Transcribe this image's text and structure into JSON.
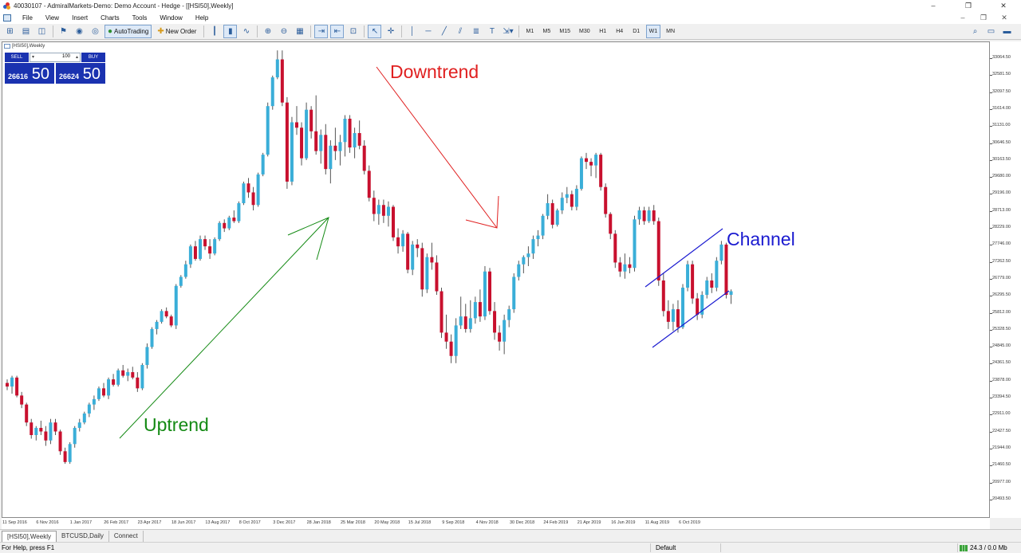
{
  "window": {
    "title": "40030107 - AdmiralMarkets-Demo: Demo Account - Hedge - [[HSI50],Weekly]",
    "controls": [
      "–",
      "❐",
      "✕"
    ]
  },
  "menu": {
    "items": [
      "File",
      "View",
      "Insert",
      "Charts",
      "Tools",
      "Window",
      "Help"
    ],
    "child_controls": [
      "–",
      "❐",
      "✕"
    ]
  },
  "toolbar": {
    "autotrading_label": "AutoTrading",
    "new_order_label": "New Order",
    "timeframes": [
      "M1",
      "M5",
      "M15",
      "M30",
      "H1",
      "H4",
      "D1",
      "W1",
      "MN"
    ],
    "active_timeframe": "W1"
  },
  "chart": {
    "header": "[HSI50],Weekly",
    "trade_panel": {
      "sell_label": "SELL",
      "buy_label": "BUY",
      "volume": "100",
      "sell_price_small": "26616",
      "sell_price_big": "50",
      "buy_price_small": "26624",
      "buy_price_big": "50"
    },
    "annotations": {
      "downtrend": "Downtrend",
      "uptrend": "Uptrend",
      "channel": "Channel"
    },
    "colors": {
      "bull": "#3aaed8",
      "bear": "#c8102e",
      "downtrend_line": "#e02020",
      "uptrend_line": "#148a14",
      "channel_line": "#1a1ad0"
    },
    "price_labels": [
      "33064.50",
      "32581.50",
      "32097.50",
      "31614.00",
      "31131.00",
      "30646.50",
      "30163.50",
      "29680.00",
      "29196.00",
      "28713.00",
      "28229.00",
      "27746.00",
      "27262.50",
      "26779.00",
      "26295.50",
      "25812.00",
      "25328.50",
      "24845.00",
      "24361.50",
      "23878.00",
      "23394.50",
      "22911.00",
      "22427.50",
      "21944.00",
      "21460.50",
      "20977.00",
      "20493.50"
    ],
    "time_labels": [
      "11 Sep 2016",
      "6 Nov 2016",
      "1 Jan 2017",
      "26 Feb 2017",
      "23 Apr 2017",
      "18 Jun 2017",
      "13 Aug 2017",
      "8 Oct 2017",
      "3 Dec 2017",
      "28 Jan 2018",
      "25 Mar 2018",
      "20 May 2018",
      "15 Jul 2018",
      "9 Sep 2018",
      "4 Nov 2018",
      "30 Dec 2018",
      "24 Feb 2019",
      "21 Apr 2019",
      "16 Jun 2019",
      "11 Aug 2019",
      "6 Oct 2019"
    ]
  },
  "chart_data": {
    "type": "candlestick",
    "symbol": "[HSI50]",
    "timeframe": "Weekly",
    "ylim": [
      20300,
      33200
    ],
    "candles": [
      [
        23900,
        24000,
        23700,
        23800
      ],
      [
        23800,
        24100,
        23600,
        24050
      ],
      [
        24050,
        24100,
        23500,
        23550
      ],
      [
        23550,
        23650,
        23200,
        23300
      ],
      [
        23300,
        23350,
        22700,
        22800
      ],
      [
        22800,
        22900,
        22350,
        22450
      ],
      [
        22450,
        22700,
        22300,
        22650
      ],
      [
        22650,
        22850,
        22450,
        22550
      ],
      [
        22550,
        22700,
        22150,
        22300
      ],
      [
        22300,
        22900,
        22200,
        22800
      ],
      [
        22800,
        22900,
        22450,
        22550
      ],
      [
        22550,
        22600,
        21900,
        22000
      ],
      [
        22000,
        22100,
        21650,
        21700
      ],
      [
        21700,
        22250,
        21650,
        22200
      ],
      [
        22200,
        22700,
        22100,
        22650
      ],
      [
        22650,
        22900,
        22550,
        22800
      ],
      [
        22800,
        23100,
        22750,
        23050
      ],
      [
        23050,
        23350,
        22950,
        23300
      ],
      [
        23300,
        23550,
        23150,
        23450
      ],
      [
        23450,
        23800,
        23400,
        23750
      ],
      [
        23750,
        23900,
        23500,
        23550
      ],
      [
        23550,
        24050,
        23450,
        24000
      ],
      [
        24000,
        24150,
        23800,
        23850
      ],
      [
        23850,
        24300,
        23800,
        24250
      ],
      [
        24250,
        24400,
        24050,
        24100
      ],
      [
        24100,
        24300,
        23950,
        24200
      ],
      [
        24200,
        24350,
        24000,
        24050
      ],
      [
        24050,
        24200,
        23650,
        23750
      ],
      [
        23750,
        24450,
        23700,
        24400
      ],
      [
        24400,
        25000,
        24300,
        24900
      ],
      [
        24900,
        25450,
        24850,
        25400
      ],
      [
        25400,
        25650,
        25250,
        25600
      ],
      [
        25600,
        25950,
        25550,
        25900
      ],
      [
        25900,
        26000,
        25700,
        25750
      ],
      [
        25750,
        25800,
        25450,
        25500
      ],
      [
        25500,
        26650,
        25400,
        26600
      ],
      [
        26600,
        26900,
        26550,
        26850
      ],
      [
        26850,
        27300,
        26800,
        27200
      ],
      [
        27200,
        27750,
        27100,
        27700
      ],
      [
        27700,
        27850,
        27300,
        27350
      ],
      [
        27350,
        28000,
        27300,
        27900
      ],
      [
        27900,
        28000,
        27600,
        27700
      ],
      [
        27700,
        27900,
        27350,
        27500
      ],
      [
        27500,
        27950,
        27450,
        27900
      ],
      [
        27900,
        28400,
        27850,
        28350
      ],
      [
        28350,
        28450,
        28100,
        28200
      ],
      [
        28200,
        28550,
        28150,
        28500
      ],
      [
        28500,
        28700,
        28350,
        28400
      ],
      [
        28400,
        28950,
        28350,
        28900
      ],
      [
        28900,
        29500,
        28850,
        29450
      ],
      [
        29450,
        29600,
        29050,
        29200
      ],
      [
        29200,
        29350,
        28700,
        28850
      ],
      [
        28850,
        29750,
        28800,
        29700
      ],
      [
        29700,
        30300,
        29650,
        30250
      ],
      [
        30250,
        31700,
        30200,
        31600
      ],
      [
        31600,
        32450,
        31500,
        32400
      ],
      [
        32400,
        33150,
        32350,
        32900
      ],
      [
        32900,
        33150,
        31600,
        31700
      ],
      [
        31700,
        31850,
        29300,
        29500
      ],
      [
        29500,
        31300,
        29400,
        31150
      ],
      [
        31150,
        31600,
        30800,
        31000
      ],
      [
        31000,
        31150,
        29950,
        30150
      ],
      [
        30150,
        31700,
        30100,
        31500
      ],
      [
        31500,
        31600,
        30700,
        30900
      ],
      [
        30900,
        31900,
        30250,
        30350
      ],
      [
        30350,
        30950,
        30000,
        30800
      ],
      [
        30800,
        31100,
        29700,
        29850
      ],
      [
        29850,
        30650,
        29450,
        30500
      ],
      [
        30500,
        31000,
        30100,
        30350
      ],
      [
        30350,
        30800,
        29950,
        30600
      ],
      [
        30600,
        31350,
        30200,
        31250
      ],
      [
        31250,
        31350,
        30300,
        30450
      ],
      [
        30450,
        31000,
        30150,
        30850
      ],
      [
        30850,
        31200,
        30400,
        30500
      ],
      [
        30500,
        30650,
        29700,
        29800
      ],
      [
        29800,
        29950,
        28950,
        29050
      ],
      [
        29050,
        29250,
        28400,
        28600
      ],
      [
        28600,
        29000,
        28300,
        28850
      ],
      [
        28850,
        29000,
        28350,
        28550
      ],
      [
        28550,
        28950,
        28250,
        28800
      ],
      [
        28800,
        28850,
        27850,
        27950
      ],
      [
        27950,
        28200,
        27500,
        27700
      ],
      [
        27700,
        28150,
        27550,
        28050
      ],
      [
        28050,
        28100,
        26950,
        27050
      ],
      [
        27050,
        27850,
        26900,
        27750
      ],
      [
        27750,
        27900,
        27400,
        27650
      ],
      [
        27650,
        27800,
        26300,
        26500
      ],
      [
        26500,
        27500,
        26400,
        27400
      ],
      [
        27400,
        27800,
        27050,
        27250
      ],
      [
        27250,
        27450,
        26350,
        26450
      ],
      [
        26450,
        26550,
        25150,
        25300
      ],
      [
        25300,
        25800,
        24850,
        25050
      ],
      [
        25050,
        25250,
        24450,
        24650
      ],
      [
        24650,
        25700,
        24450,
        25500
      ],
      [
        25500,
        26300,
        25400,
        25750
      ],
      [
        25750,
        26100,
        25300,
        25400
      ],
      [
        25400,
        26200,
        25300,
        25700
      ],
      [
        25700,
        26300,
        25550,
        26150
      ],
      [
        26150,
        26500,
        25600,
        25750
      ],
      [
        25750,
        27150,
        25650,
        27000
      ],
      [
        27000,
        27100,
        25800,
        25900
      ],
      [
        25900,
        26150,
        25100,
        25300
      ],
      [
        25300,
        25500,
        24800,
        25050
      ],
      [
        25050,
        25800,
        24700,
        25650
      ],
      [
        25650,
        26050,
        25450,
        25950
      ],
      [
        25950,
        26950,
        25850,
        26850
      ],
      [
        26850,
        27300,
        26750,
        27200
      ],
      [
        27200,
        27450,
        26950,
        27400
      ],
      [
        27400,
        27700,
        27150,
        27500
      ],
      [
        27500,
        28000,
        27350,
        27900
      ],
      [
        27900,
        28150,
        27700,
        28000
      ],
      [
        28000,
        28600,
        27900,
        28550
      ],
      [
        28550,
        29150,
        28450,
        28900
      ],
      [
        28900,
        29000,
        28200,
        28300
      ],
      [
        28300,
        28750,
        28250,
        28700
      ],
      [
        28700,
        29200,
        28600,
        29050
      ],
      [
        29050,
        29350,
        28900,
        29150
      ],
      [
        29150,
        29250,
        28700,
        28800
      ],
      [
        28800,
        29400,
        28700,
        29300
      ],
      [
        29300,
        30200,
        29250,
        30150
      ],
      [
        30150,
        30300,
        29850,
        30050
      ],
      [
        30050,
        30150,
        29650,
        29950
      ],
      [
        29950,
        30300,
        29600,
        30250
      ],
      [
        30250,
        30300,
        29250,
        29350
      ],
      [
        29350,
        29450,
        28500,
        28600
      ],
      [
        28600,
        28650,
        27900,
        28050
      ],
      [
        28050,
        28150,
        27100,
        27250
      ],
      [
        27250,
        27400,
        26850,
        27000
      ],
      [
        27000,
        27500,
        26800,
        27200
      ],
      [
        27200,
        27400,
        26950,
        27100
      ],
      [
        27100,
        28550,
        27000,
        28450
      ],
      [
        28450,
        28800,
        28300,
        28700
      ],
      [
        28700,
        28800,
        28300,
        28400
      ],
      [
        28400,
        28800,
        28350,
        28700
      ],
      [
        28700,
        28850,
        28300,
        28400
      ],
      [
        28400,
        28500,
        26600,
        26750
      ],
      [
        26750,
        26950,
        25750,
        25900
      ],
      [
        25900,
        26200,
        25400,
        25600
      ],
      [
        25600,
        26100,
        25350,
        25950
      ],
      [
        25950,
        26200,
        25300,
        25450
      ],
      [
        25450,
        26650,
        25400,
        26550
      ],
      [
        26550,
        27300,
        26450,
        27200
      ],
      [
        27200,
        27300,
        26100,
        26250
      ],
      [
        26250,
        26400,
        25650,
        25800
      ],
      [
        25800,
        26450,
        25700,
        26350
      ],
      [
        26350,
        26850,
        26250,
        26750
      ],
      [
        26750,
        26950,
        26400,
        26550
      ],
      [
        26550,
        27400,
        26450,
        27300
      ],
      [
        27300,
        27850,
        27200,
        27750
      ],
      [
        27750,
        27800,
        26250,
        26350
      ],
      [
        26350,
        26500,
        26100,
        26450
      ]
    ]
  }
}
